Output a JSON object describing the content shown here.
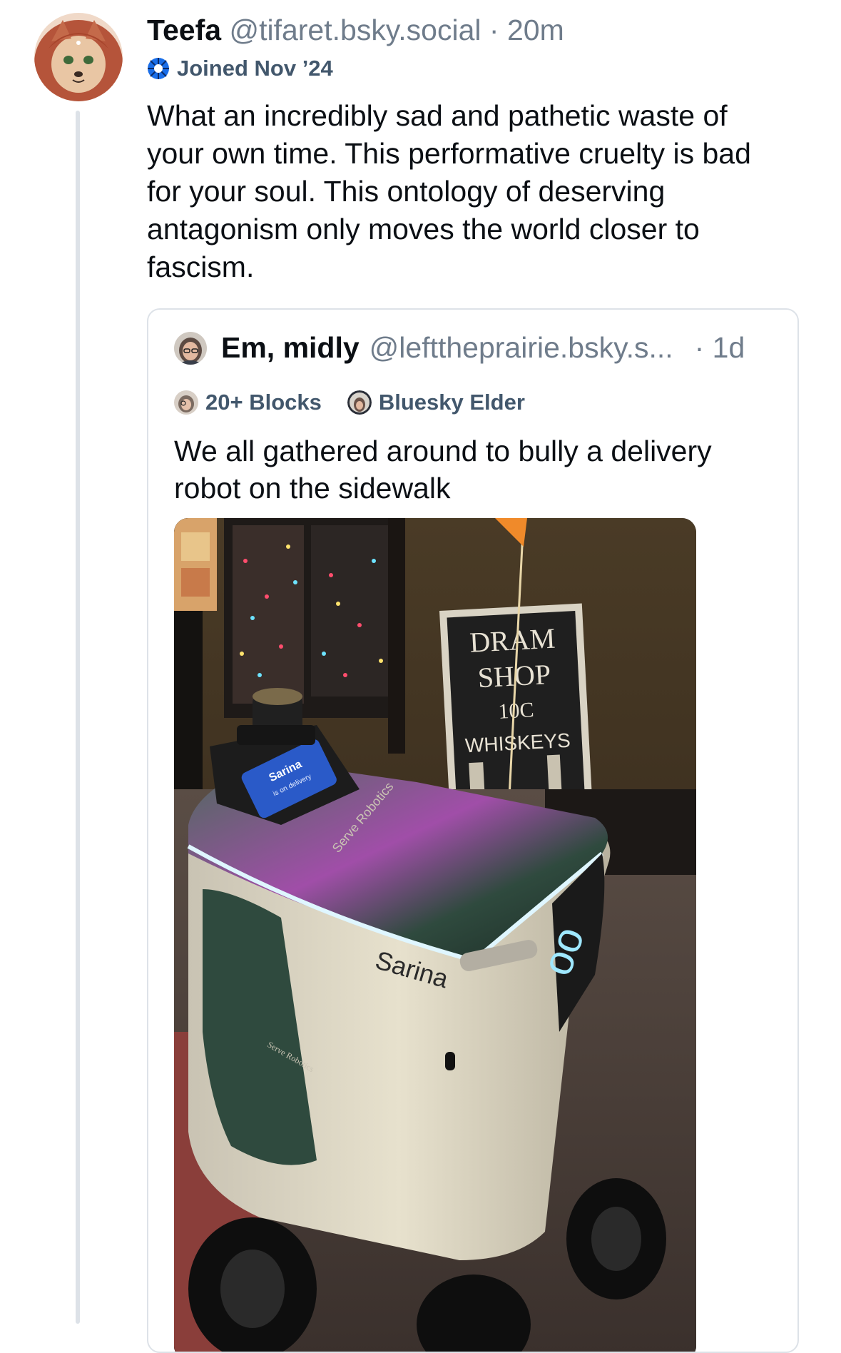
{
  "post": {
    "display_name": "Teefa",
    "handle": "@tifaret.bsky.social",
    "separator": "·",
    "time": "20m",
    "joined_badge": "Joined Nov ’24",
    "text": "What an incredibly sad and pathetic waste of your own time. This performative cruelty is bad for your soul. This ontology of deserving antagonism only moves the world closer to fascism."
  },
  "quote": {
    "display_name": "Em, midly",
    "handle": "@lefttheprairie.bsky.s...",
    "time": "· 1d",
    "badges": [
      {
        "label": "20+ Blocks",
        "icon": "blocks-badge-icon"
      },
      {
        "label": "Bluesky Elder",
        "icon": "elder-badge-icon"
      }
    ],
    "text": "We all gathered around to bully a delivery robot on the sidewalk",
    "image": {
      "sign_lines": [
        "DRAM",
        "SHOP",
        "10C",
        "WHISKEYS"
      ],
      "screen_name": "Sarina",
      "screen_status": "is on delivery",
      "brand_lid": "Serve Robotics",
      "body_name": "Sarina",
      "brand_side": "Serve Robotics"
    }
  },
  "colors": {
    "text": "#0b0f14",
    "secondary": "#6f7c8b",
    "badge": "#42576c",
    "border": "#dde2e8",
    "avatar_hair": "#b5543a"
  }
}
